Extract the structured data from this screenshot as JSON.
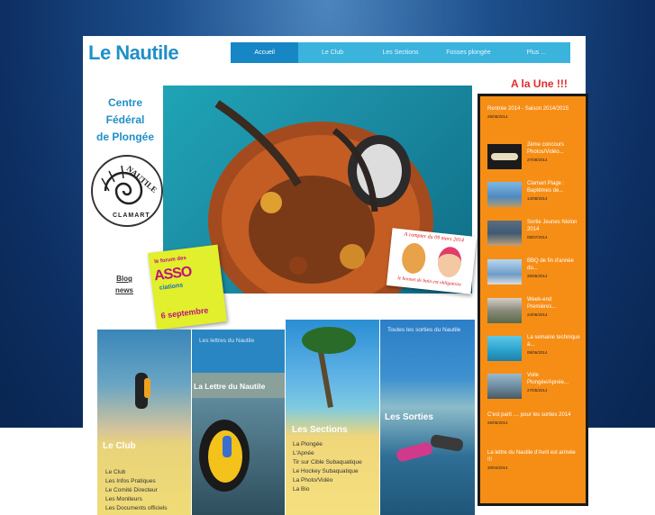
{
  "site": {
    "logo": "Le Nautile"
  },
  "nav": {
    "items": [
      "Accueil",
      "Le Club",
      "Les Sections",
      "Fosses plongée",
      "Plus ..."
    ],
    "active": "Accueil"
  },
  "une_title": "A la Une !!!",
  "left": {
    "centre_lines": [
      "Centre",
      "Fédéral",
      "de Plongée"
    ],
    "logo_text": [
      "NAUTILE",
      "CLAMART"
    ],
    "blog": [
      "Blog",
      "news"
    ]
  },
  "asso": {
    "line1": "le forum des",
    "line2": "ASSO",
    "line3": "ciations",
    "line4": "6 septembre"
  },
  "scooter": {
    "caption_top": "A compter du 09 mars 2014",
    "caption_bottom": "le bonnet de bain est obligatoire"
  },
  "tiles": {
    "club": {
      "label": "Le Club",
      "links": [
        "Le Club",
        "Les Infos Pratiques",
        "Le Comité Directeur",
        "Les Moniteurs",
        "Les Documents officiels"
      ]
    },
    "lettre": {
      "header": "Les lettres du Nautile",
      "label": "La Lettre du Nautile"
    },
    "sections": {
      "label": "Les Sections",
      "links": [
        "La Plongée",
        "L'Apnée",
        "Tir sur Cible Subaquatique",
        "Le Hockey Subaquatique",
        "La Photo/Vidéo",
        "La Bio"
      ]
    },
    "sorties": {
      "header": "Toutes les sorties du Nautile",
      "label": "Les Sorties"
    }
  },
  "side": {
    "items": [
      {
        "title": "Rentrée 2014 - Saison 2014/2015",
        "date": "28/08/2014"
      },
      {
        "title": "2ème concours Photos/Vidéo...",
        "date": "27/08/2014"
      },
      {
        "title": "Clamart Plage : Baptêmes de...",
        "date": "14/08/2014"
      },
      {
        "title": "Sortie Jeunes Niolon 2014",
        "date": "08/07/2014"
      },
      {
        "title": "BBQ de fin d'année du...",
        "date": "25/06/2014"
      },
      {
        "title": "Week-end Premières...",
        "date": "24/06/2014"
      },
      {
        "title": "La semaine technique à...",
        "date": "09/06/2014"
      },
      {
        "title": "Voile Plongée/Apnée...",
        "date": "27/05/2014"
      },
      {
        "title": "C'est parti .... pour les sorties 2014",
        "date": "26/05/2014"
      },
      {
        "title": "La lettre du Nautile d'Avril est arrivée !!!",
        "date": "30/04/2014"
      }
    ]
  },
  "colors": {
    "brand": "#1f8fc9",
    "nav": "#3ab3dd",
    "nav_active": "#1686c5",
    "sidebar": "#f68e16",
    "une": "#e12b2b"
  }
}
